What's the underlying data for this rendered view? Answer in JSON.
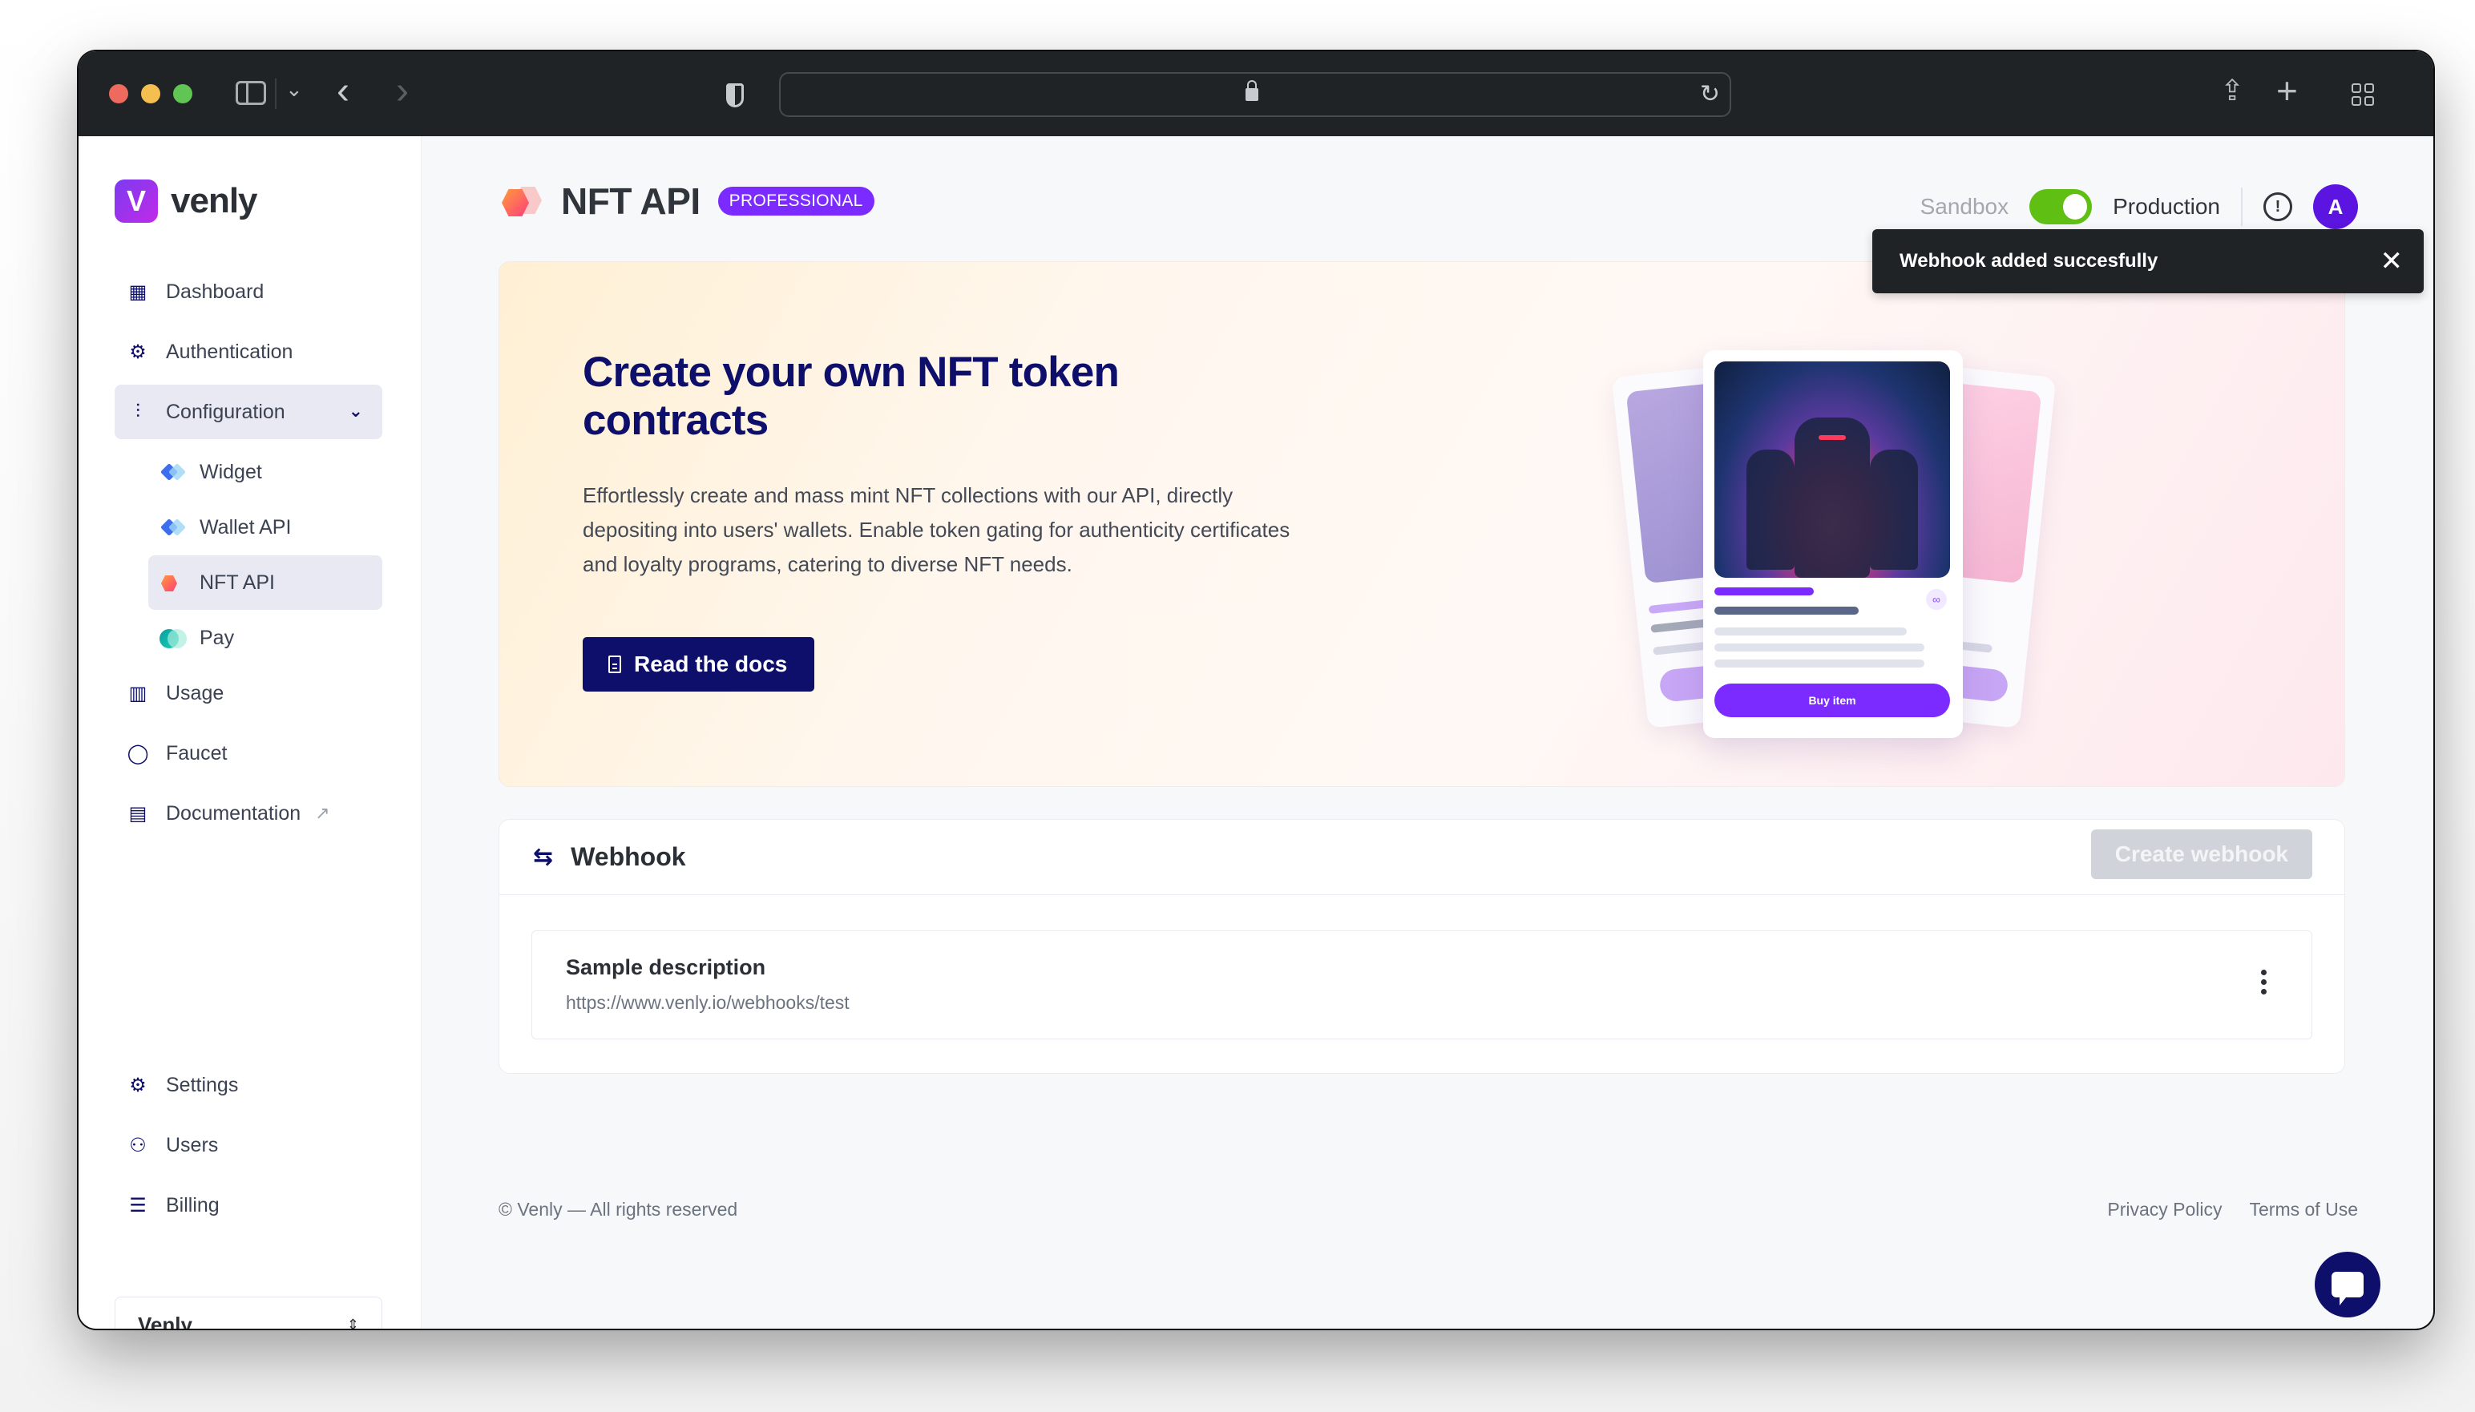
{
  "browser": {
    "icons": [
      "close-dot",
      "minimize-dot",
      "zoom-dot",
      "sidebar-toggle-icon",
      "chevron-down-icon",
      "back-icon",
      "forward-icon",
      "shield-icon",
      "lock-icon",
      "reload-icon",
      "share-icon",
      "plus-icon",
      "tabs-grid-icon"
    ],
    "back_glyph": "‹",
    "forward_glyph": "›",
    "reload_glyph": "↻",
    "share_glyph": "⇪",
    "plus_glyph": "+",
    "chevron_glyph": "⌄"
  },
  "brand": {
    "logo_letter": "V",
    "name": "venly"
  },
  "sidebar": {
    "items": [
      {
        "label": "Dashboard",
        "icon": "dashboard-grid-icon",
        "glyph": "▦"
      },
      {
        "label": "Authentication",
        "icon": "gear-icon",
        "glyph": "⚙"
      },
      {
        "label": "Configuration",
        "icon": "sliders-icon",
        "glyph": "⫶",
        "expanded": true,
        "chevron": "⌄"
      }
    ],
    "sub_items": [
      {
        "label": "Widget",
        "icon": "widget-product-icon"
      },
      {
        "label": "Wallet API",
        "icon": "wallet-api-product-icon"
      },
      {
        "label": "NFT API",
        "icon": "nft-api-product-icon",
        "active": true
      },
      {
        "label": "Pay",
        "icon": "pay-product-icon"
      }
    ],
    "lower_items": [
      {
        "label": "Usage",
        "icon": "chart-icon",
        "glyph": "▥"
      },
      {
        "label": "Faucet",
        "icon": "drop-icon",
        "glyph": "◯"
      },
      {
        "label": "Documentation",
        "icon": "document-icon",
        "glyph": "▤",
        "external_glyph": "↗"
      }
    ],
    "bottom_items": [
      {
        "label": "Settings",
        "icon": "gear-icon",
        "glyph": "⚙"
      },
      {
        "label": "Users",
        "icon": "users-icon",
        "glyph": "⚇"
      },
      {
        "label": "Billing",
        "icon": "billing-icon",
        "glyph": "☰"
      }
    ],
    "org_select": {
      "value": "Venly",
      "glyph": "⇕"
    }
  },
  "header": {
    "title": "NFT API",
    "badge": "PROFESSIONAL",
    "env_sandbox": "Sandbox",
    "env_production": "Production",
    "env_toggle_on": true,
    "help_glyph": "!",
    "avatar_initial": "A"
  },
  "toast": {
    "message": "Webhook added succesfully",
    "close_glyph": "✕"
  },
  "hero": {
    "title": "Create your own NFT token contracts",
    "description": "Effortlessly create and mass mint NFT collections with our API, directly depositing into users' wallets. Enable token gating for authenticity certificates and loyalty programs, catering to diverse NFT needs.",
    "button_label": "Read the docs",
    "illustration": {
      "buy_label": "Buy item",
      "chain_glyph": "∞"
    }
  },
  "webhook": {
    "title": "Webhook",
    "icon_glyph": "⇆",
    "create_label": "Create webhook",
    "create_disabled": true,
    "entries": [
      {
        "description": "Sample description",
        "url": "https://www.venly.io/webhooks/test"
      }
    ]
  },
  "footer": {
    "copyright": "© Venly — All rights reserved",
    "links": [
      "Privacy Policy",
      "Terms of Use"
    ]
  },
  "colors": {
    "brand_navy": "#0e0f6b",
    "brand_purple": "#7b2bff",
    "toggle_green": "#5fbf13",
    "avatar_purple": "#5c14e0",
    "toast_bg": "#202326"
  }
}
